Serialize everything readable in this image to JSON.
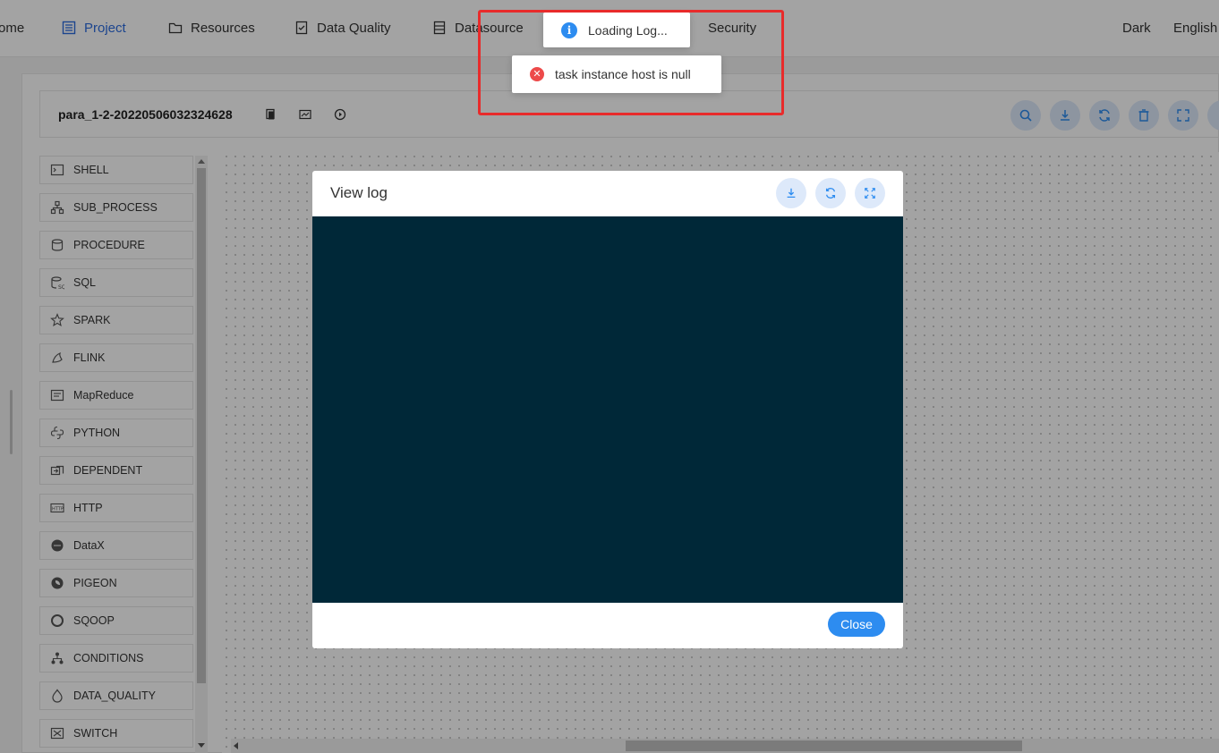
{
  "nav": {
    "items": [
      {
        "label": "ome",
        "icon": "home-icon"
      },
      {
        "label": "Project",
        "icon": "project-icon"
      },
      {
        "label": "Resources",
        "icon": "folder-icon"
      },
      {
        "label": "Data Quality",
        "icon": "data-quality-icon"
      },
      {
        "label": "Datasource",
        "icon": "datasource-icon"
      },
      {
        "label": "Security",
        "icon": "security-icon"
      }
    ],
    "theme_label": "Dark",
    "language_label": "English"
  },
  "toolbar": {
    "workflow_name": "para_1-2-20220506032324628",
    "actions": [
      "search-icon",
      "download-icon",
      "refresh-icon",
      "delete-icon",
      "fullscreen-icon"
    ]
  },
  "palette": {
    "items": [
      {
        "label": "SHELL",
        "icon": "shell-icon"
      },
      {
        "label": "SUB_PROCESS",
        "icon": "sub-process-icon"
      },
      {
        "label": "PROCEDURE",
        "icon": "procedure-icon"
      },
      {
        "label": "SQL",
        "icon": "sql-icon"
      },
      {
        "label": "SPARK",
        "icon": "spark-icon"
      },
      {
        "label": "FLINK",
        "icon": "flink-icon"
      },
      {
        "label": "MapReduce",
        "icon": "mapreduce-icon"
      },
      {
        "label": "PYTHON",
        "icon": "python-icon"
      },
      {
        "label": "DEPENDENT",
        "icon": "dependent-icon"
      },
      {
        "label": "HTTP",
        "icon": "http-icon"
      },
      {
        "label": "DataX",
        "icon": "datax-icon"
      },
      {
        "label": "PIGEON",
        "icon": "pigeon-icon"
      },
      {
        "label": "SQOOP",
        "icon": "sqoop-icon"
      },
      {
        "label": "CONDITIONS",
        "icon": "conditions-icon"
      },
      {
        "label": "DATA_QUALITY",
        "icon": "data-quality-task-icon"
      },
      {
        "label": "SWITCH",
        "icon": "switch-icon"
      }
    ]
  },
  "modal": {
    "title": "View log",
    "close_label": "Close",
    "header_actions": [
      "download-icon",
      "refresh-icon",
      "fullscreen-icon"
    ],
    "log_background": "#002838"
  },
  "toasts": {
    "info": "Loading Log...",
    "error": "task instance host is null"
  },
  "colors": {
    "accent": "#2d8cf0",
    "nav_active": "#2d6cdf",
    "error": "#ed4a4a",
    "highlight": "#e82b2b"
  }
}
